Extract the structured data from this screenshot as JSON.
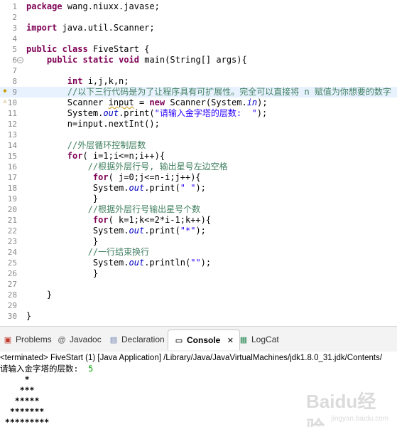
{
  "editor": {
    "lines": [
      {
        "n": "1",
        "parts": [
          {
            "t": "package",
            "c": "kw"
          },
          {
            "t": " wang.niuxx.javase;"
          }
        ]
      },
      {
        "n": "2",
        "parts": []
      },
      {
        "n": "3",
        "parts": [
          {
            "t": "import",
            "c": "kw"
          },
          {
            "t": " java.util.Scanner;"
          }
        ]
      },
      {
        "n": "4",
        "parts": []
      },
      {
        "n": "5",
        "parts": [
          {
            "t": "public",
            "c": "kw"
          },
          {
            "t": " "
          },
          {
            "t": "class",
            "c": "kw"
          },
          {
            "t": " FiveStart {"
          }
        ]
      },
      {
        "n": "6",
        "parts": [
          {
            "t": "    "
          },
          {
            "t": "public",
            "c": "kw"
          },
          {
            "t": " "
          },
          {
            "t": "static",
            "c": "kw"
          },
          {
            "t": " "
          },
          {
            "t": "void",
            "c": "kw"
          },
          {
            "t": " main(String[] args){"
          }
        ],
        "fold": "−"
      },
      {
        "n": "7",
        "parts": []
      },
      {
        "n": "8",
        "parts": [
          {
            "t": "        "
          },
          {
            "t": "int",
            "c": "kw"
          },
          {
            "t": " i,j,k,n;"
          }
        ]
      },
      {
        "n": "9",
        "parts": [
          {
            "t": "        "
          },
          {
            "t": "//以下三行代码是为了让程序具有可扩展性。完全可以直接将 n 赋值为你想要的数字",
            "c": "cm"
          }
        ],
        "highlight": true,
        "marker": "hint"
      },
      {
        "n": "10",
        "parts": [
          {
            "t": "        Scanner "
          },
          {
            "t": "input",
            "c": "warn"
          },
          {
            "t": " = "
          },
          {
            "t": "new",
            "c": "kw"
          },
          {
            "t": " Scanner(System."
          },
          {
            "t": "in",
            "c": "fld"
          },
          {
            "t": ");"
          }
        ],
        "marker": "warnicon"
      },
      {
        "n": "11",
        "parts": [
          {
            "t": "        System."
          },
          {
            "t": "out",
            "c": "fld"
          },
          {
            "t": ".print("
          },
          {
            "t": "\"请输入金字塔的层数:  \"",
            "c": "st"
          },
          {
            "t": ");"
          }
        ]
      },
      {
        "n": "12",
        "parts": [
          {
            "t": "        n=input.nextInt();"
          }
        ]
      },
      {
        "n": "13",
        "parts": []
      },
      {
        "n": "14",
        "parts": [
          {
            "t": "        "
          },
          {
            "t": "//外层循环控制层数",
            "c": "cm"
          }
        ]
      },
      {
        "n": "15",
        "parts": [
          {
            "t": "        "
          },
          {
            "t": "for",
            "c": "kw"
          },
          {
            "t": "( i=1;i<=n;i++){"
          }
        ]
      },
      {
        "n": "16",
        "parts": [
          {
            "t": "            "
          },
          {
            "t": "//根据外层行号, 输出星号左边空格",
            "c": "cm"
          }
        ]
      },
      {
        "n": "17",
        "parts": [
          {
            "t": "             "
          },
          {
            "t": "for",
            "c": "kw"
          },
          {
            "t": "( j=0;j<=n-i;j++){"
          }
        ]
      },
      {
        "n": "18",
        "parts": [
          {
            "t": "             System."
          },
          {
            "t": "out",
            "c": "fld"
          },
          {
            "t": ".print("
          },
          {
            "t": "\" \"",
            "c": "st"
          },
          {
            "t": ");"
          }
        ]
      },
      {
        "n": "19",
        "parts": [
          {
            "t": "             }"
          }
        ]
      },
      {
        "n": "20",
        "parts": [
          {
            "t": "            "
          },
          {
            "t": "//根据外层行号输出星号个数",
            "c": "cm"
          }
        ]
      },
      {
        "n": "21",
        "parts": [
          {
            "t": "             "
          },
          {
            "t": "for",
            "c": "kw"
          },
          {
            "t": "( k=1;k<=2*i-1;k++){"
          }
        ]
      },
      {
        "n": "22",
        "parts": [
          {
            "t": "             System."
          },
          {
            "t": "out",
            "c": "fld"
          },
          {
            "t": ".print("
          },
          {
            "t": "\"*\"",
            "c": "st"
          },
          {
            "t": ");"
          }
        ]
      },
      {
        "n": "23",
        "parts": [
          {
            "t": "             }"
          }
        ]
      },
      {
        "n": "24",
        "parts": [
          {
            "t": "            "
          },
          {
            "t": "//一行结束换行",
            "c": "cm"
          }
        ]
      },
      {
        "n": "25",
        "parts": [
          {
            "t": "             System."
          },
          {
            "t": "out",
            "c": "fld"
          },
          {
            "t": ".println("
          },
          {
            "t": "\"\"",
            "c": "st"
          },
          {
            "t": ");"
          }
        ]
      },
      {
        "n": "26",
        "parts": [
          {
            "t": "             }"
          }
        ]
      },
      {
        "n": "27",
        "parts": []
      },
      {
        "n": "28",
        "parts": [
          {
            "t": "    }"
          }
        ]
      },
      {
        "n": "29",
        "parts": []
      },
      {
        "n": "30",
        "parts": [
          {
            "t": "}"
          }
        ]
      }
    ]
  },
  "tabs": {
    "problems": {
      "label": "Problems",
      "icon": "problems-icon"
    },
    "javadoc": {
      "label": "Javadoc",
      "icon": "at-icon"
    },
    "declaration": {
      "label": "Declaration",
      "icon": "declaration-icon"
    },
    "console": {
      "label": "Console",
      "icon": "console-icon",
      "close": "✕"
    },
    "logcat": {
      "label": "LogCat",
      "icon": "logcat-icon"
    }
  },
  "console": {
    "terminated": "<terminated> FiveStart (1) [Java Application] /Library/Java/JavaVirtualMachines/jdk1.8.0_31.jdk/Contents/",
    "prompt": "请输入金字塔的层数:  ",
    "user_input": "5",
    "output": [
      "     *",
      "    ***",
      "   *****",
      "  *******",
      " *********"
    ]
  },
  "watermark": {
    "big": "Baidu经验",
    "small": "jingyan.baidu.com"
  },
  "colors": {
    "keyword": "#7f0055",
    "comment": "#3f7f5f",
    "string": "#2a00ff",
    "field": "#0000c0",
    "highlight_line": "#e8f2fe",
    "console_input": "#00a000"
  }
}
